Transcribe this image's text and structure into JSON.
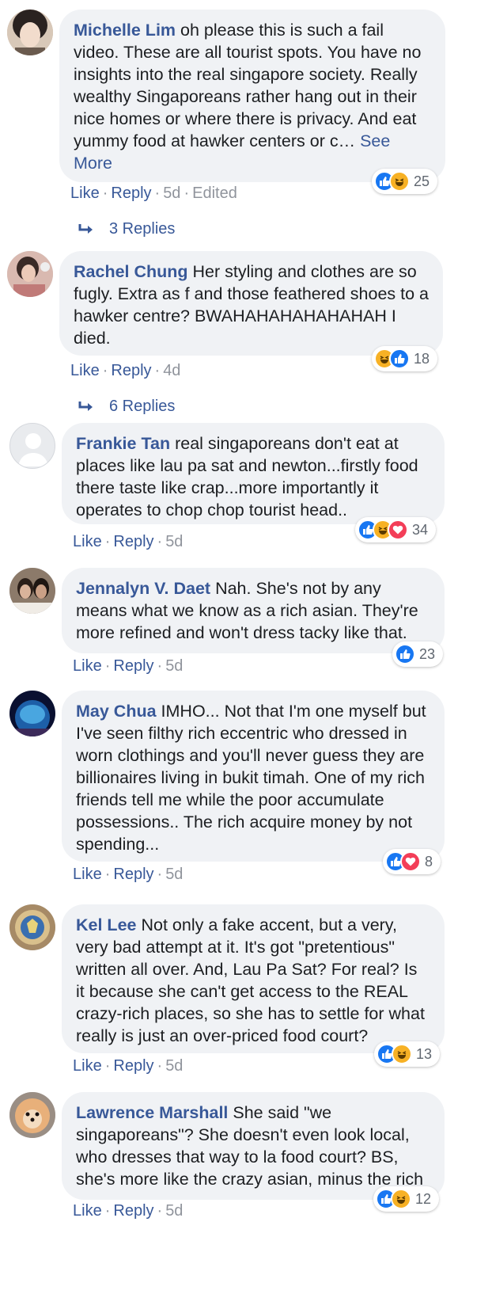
{
  "comments": [
    {
      "author": "Michelle Lim",
      "text": "oh please this is such a fail video. These are all tourist spots. You have no insights into the real singapore society. Really wealthy Singaporeans rather hang out in their nice homes or where there is privacy. And eat yummy food at hawker centers or c…",
      "see_more": "See More",
      "like": "Like",
      "reply": "Reply",
      "time": "5d",
      "edited": "Edited",
      "reactions": [
        "like",
        "haha"
      ],
      "count": "25",
      "replies": "3 Replies"
    },
    {
      "author": "Rachel Chung",
      "text": "Her styling and clothes are so fugly. Extra as f and those feathered shoes to a hawker centre? BWAHAHAHAHAHAHAH I died.",
      "like": "Like",
      "reply": "Reply",
      "time": "4d",
      "reactions": [
        "haha",
        "like"
      ],
      "count": "18",
      "replies": "6 Replies"
    },
    {
      "author": "Frankie Tan",
      "text": "real singaporeans don't eat at places like lau pa sat and newton...firstly food there taste like crap...more importantly it operates to chop chop tourist head..",
      "like": "Like",
      "reply": "Reply",
      "time": "5d",
      "reactions": [
        "like",
        "haha",
        "love"
      ],
      "count": "34"
    },
    {
      "author": "Jennalyn V. Daet",
      "text": "Nah. She's not by any means what we know as a rich asian. They're more refined and won't dress tacky like that.",
      "like": "Like",
      "reply": "Reply",
      "time": "5d",
      "reactions": [
        "like"
      ],
      "count": "23"
    },
    {
      "author": "May Chua",
      "text": "IMHO... Not that I'm one myself but I've seen filthy rich eccentric who dressed in worn clothings and you'll never guess they are billionaires living in bukit timah. One of my rich friends tell me while the poor accumulate possessions.. The rich acquire money by not spending...",
      "like": "Like",
      "reply": "Reply",
      "time": "5d",
      "reactions": [
        "like",
        "love"
      ],
      "count": "8"
    },
    {
      "author": "Kel Lee",
      "text": "Not only a fake accent, but a very, very bad attempt at it. It's got \"pretentious\" written all over. And, Lau Pa Sat? For real? Is it because she can't get access to the REAL crazy-rich places, so she has to settle for what really is just an over-priced food court?",
      "like": "Like",
      "reply": "Reply",
      "time": "5d",
      "reactions": [
        "like",
        "haha"
      ],
      "count": "13"
    },
    {
      "author": "Lawrence Marshall",
      "text": "She said \"we singaporeans\"? She doesn't even look local, who dresses that way to la food court? BS, she's more like the crazy asian, minus the rich",
      "like": "Like",
      "reply": "Reply",
      "time": "5d",
      "reactions": [
        "like",
        "haha"
      ],
      "count": "12"
    }
  ],
  "colors": {
    "link": "#385898",
    "bubble": "#f0f2f5",
    "meta": "#90949c",
    "like": "#1877f2",
    "haha": "#f7b125",
    "love": "#f33e58"
  }
}
